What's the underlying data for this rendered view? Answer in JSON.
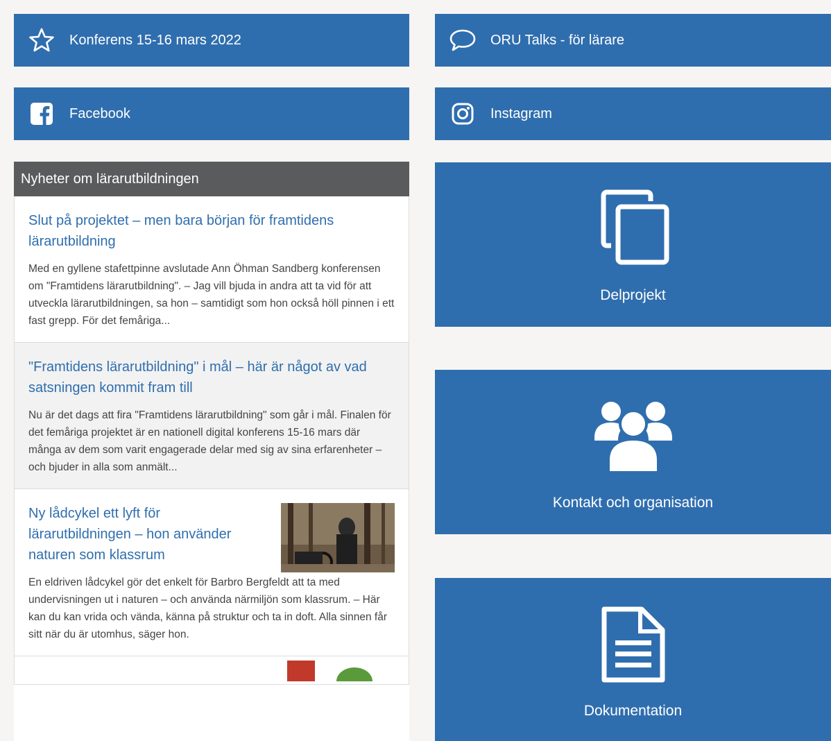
{
  "top_links": {
    "conference": "Konferens 15-16 mars 2022",
    "oru_talks": "ORU Talks - för lärare",
    "facebook": "Facebook",
    "instagram": "Instagram"
  },
  "news": {
    "heading": "Nyheter om lärarutbildningen",
    "items": [
      {
        "title": "Slut på projektet – men bara början för framtidens lärarutbildning",
        "text": "Med en gyllene stafettpinne avslutade Ann Öhman Sandberg konferensen om \"Framtidens lärarutbildning\". – Jag vill bjuda in andra att ta vid för att utveckla lärarutbildningen, sa hon – samtidigt som hon också höll pinnen i ett fast grepp. För det femåriga..."
      },
      {
        "title": "\"Framtidens lärarutbildning\" i mål – här är något av vad satsningen kommit fram till",
        "text": "Nu är det dags att fira \"Framtidens lärarutbildning\" som går i mål. Finalen för det femåriga projektet är en nationell digital konferens 15-16 mars där många av dem som varit engagerade delar med sig av sina erfarenheter – och bjuder in alla som anmält..."
      },
      {
        "title": "Ny lådcykel ett lyft för lärarutbildningen – hon använder naturen som klassrum",
        "text": "En eldriven lådcykel gör det enkelt för Barbro Bergfeldt att ta med undervisningen ut i naturen – och använda närmiljön som klassrum. – Här kan du kan vrida och vända, känna på struktur och ta in doft. Alla sinnen får sitt när du är utomhus, säger hon."
      }
    ]
  },
  "tiles": {
    "delprojekt": "Delprojekt",
    "kontakt": "Kontakt och organisation",
    "dokumentation": "Dokumentation"
  },
  "colors": {
    "brand_blue": "#2f6eae",
    "header_gray": "#5a5b5c",
    "background": "#f6f5f3"
  }
}
